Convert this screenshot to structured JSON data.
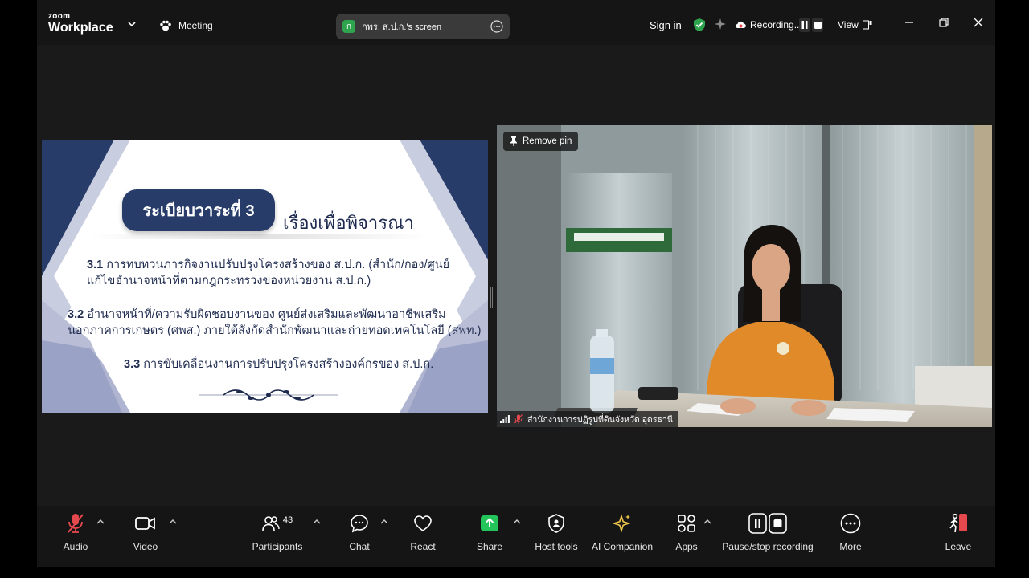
{
  "app": {
    "logo_line1": "zoom",
    "logo_line2": "Workplace"
  },
  "topbar": {
    "meeting_label": "Meeting",
    "share_badge": "ก",
    "share_label": "กพร. ส.ป.ก.'s screen",
    "sign_in": "Sign in",
    "recording_label": "Recording...",
    "view_label": "View"
  },
  "slide": {
    "title": "ระเบียบวาระที่ 3",
    "title_side": "เรื่องเพื่อพิจารณา",
    "items": [
      {
        "num": "3.1",
        "line1": "การทบทวนภารกิจงานปรับปรุงโครงสร้างของ ส.ป.ก. (สำนัก/กอง/ศูนย์",
        "line2": "แก้ไขอำนาจหน้าที่ตามกฎกระทรวงของหน่วยงาน ส.ป.ก.)"
      },
      {
        "num": "3.2",
        "line1": "อำนาจหน้าที่/ความรับผิดชอบงานของ ศูนย์ส่งเสริมและพัฒนาอาชีพเสริม",
        "line2": "นอกภาคการเกษตร (ศพส.) ภายใต้สังกัดสำนักพัฒนาและถ่ายทอดเทคโนโลยี (สพท.)"
      },
      {
        "num": "3.3",
        "line1": "การขับเคลื่อนงานการปรับปรุงโครงสร้างองค์กรของ ส.ป.ก.",
        "line2": ""
      }
    ]
  },
  "camera": {
    "remove_pin": "Remove pin",
    "participant_name": "สำนักงานการปฏิรูปที่ดินจังหวัด อุดรธานี"
  },
  "toolbar": {
    "audio": "Audio",
    "video": "Video",
    "participants": "Participants",
    "participants_count": "43",
    "chat": "Chat",
    "react": "React",
    "share": "Share",
    "host_tools": "Host tools",
    "ai_companion": "AI Companion",
    "apps": "Apps",
    "pause_stop": "Pause/stop recording",
    "more": "More",
    "leave": "Leave"
  },
  "colors": {
    "accent_green": "#2fa44f",
    "share_green": "#23c45a",
    "muted_red": "#e5484d",
    "slide_navy": "#283c6a",
    "ai_gold": "#f2c94c"
  }
}
